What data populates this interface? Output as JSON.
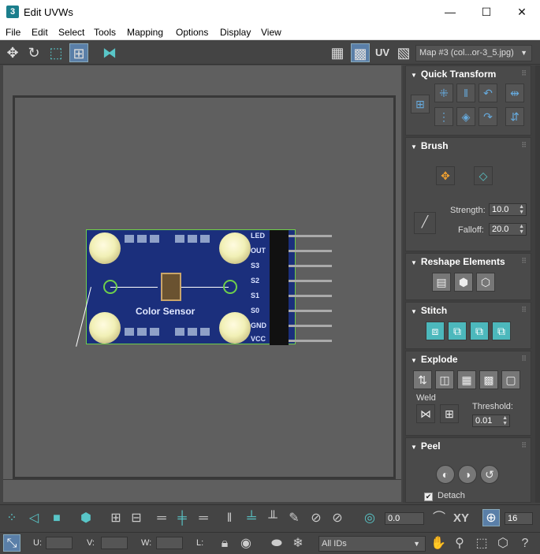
{
  "window": {
    "title": "Edit UVWs",
    "app_icon": "3",
    "minimize": "—",
    "maximize": "☐",
    "close": "✕"
  },
  "menu": [
    "File",
    "Edit",
    "Select",
    "Tools",
    "Mapping",
    "Options",
    "Display",
    "View"
  ],
  "toolbar": {
    "uv_label": "UV",
    "map_select": "Map #3 (col...or-3_5.jpg)"
  },
  "image": {
    "board_title": "Color Sensor",
    "pin_labels": [
      "LED",
      "OUT",
      "S3",
      "S2",
      "S1",
      "S0",
      "GND",
      "VCC"
    ]
  },
  "panel": {
    "quick_transform": {
      "title": "Quick Transform"
    },
    "brush": {
      "title": "Brush",
      "strength_label": "Strength:",
      "strength_value": "10.0",
      "falloff_label": "Falloff:",
      "falloff_value": "20.0"
    },
    "reshape": {
      "title": "Reshape Elements"
    },
    "stitch": {
      "title": "Stitch"
    },
    "explode": {
      "title": "Explode",
      "weld_label": "Weld",
      "threshold_label": "Threshold:",
      "threshold_value": "0.01"
    },
    "peel": {
      "title": "Peel",
      "detach_label": "Detach",
      "detach_checked": "✔"
    }
  },
  "bottom1": {
    "angle_value": "0.0",
    "xy_label": "XY",
    "grid_value": "16"
  },
  "bottom2": {
    "u_label": "U:",
    "v_label": "V:",
    "w_label": "W:",
    "l_label": "L:",
    "ids_select": "All IDs"
  }
}
